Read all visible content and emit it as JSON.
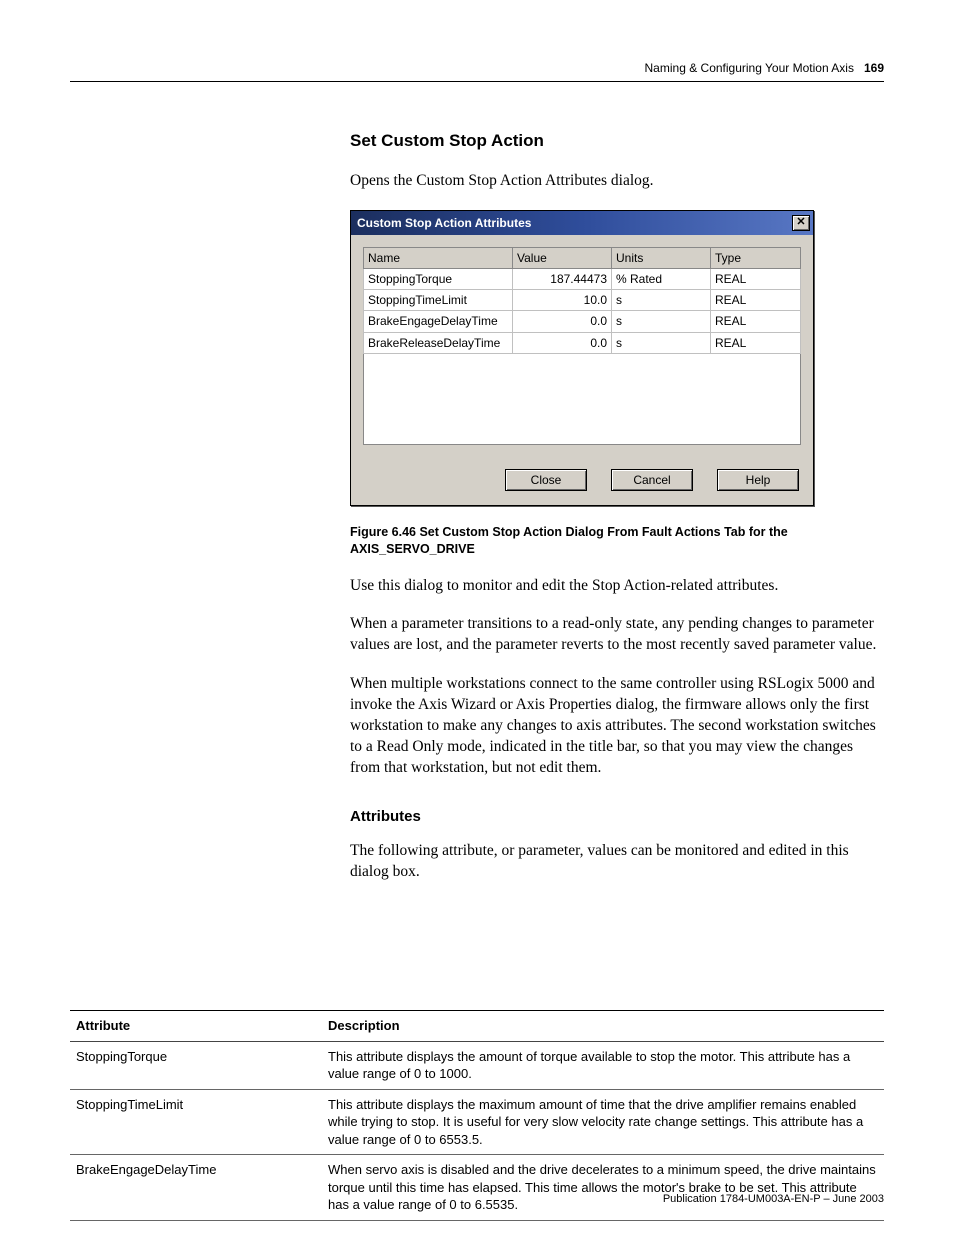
{
  "header": {
    "chapter": "Naming & Configuring Your Motion Axis",
    "page_number": "169"
  },
  "section_title": "Set Custom Stop Action",
  "intro_para": "Opens the Custom Stop Action Attributes dialog.",
  "dialog": {
    "title": "Custom Stop Action Attributes",
    "columns": [
      "Name",
      "Value",
      "Units",
      "Type"
    ],
    "rows": [
      {
        "name": "StoppingTorque",
        "value": "187.44473",
        "units": "% Rated",
        "type": "REAL"
      },
      {
        "name": "StoppingTimeLimit",
        "value": "10.0",
        "units": "s",
        "type": "REAL"
      },
      {
        "name": "BrakeEngageDelayTime",
        "value": "0.0",
        "units": "s",
        "type": "REAL"
      },
      {
        "name": "BrakeReleaseDelayTime",
        "value": "0.0",
        "units": "s",
        "type": "REAL"
      }
    ],
    "buttons": {
      "close": "Close",
      "cancel": "Cancel",
      "help": "Help"
    }
  },
  "figure_caption": "Figure 6.46 Set Custom Stop Action Dialog From Fault Actions Tab for the AXIS_SERVO_DRIVE",
  "para_use": "Use this dialog to monitor and edit the Stop Action-related attributes.",
  "para_readonly": "When a parameter transitions to a read-only state, any pending changes to parameter values are lost, and the parameter reverts to the most recently saved parameter value.",
  "para_multi": "When multiple workstations connect to the same controller using RSLogix 5000 and invoke the Axis Wizard or Axis Properties dialog, the firmware allows only the first workstation to make any changes to axis attributes. The second workstation switches to a Read Only mode, indicated in the title bar, so that you may view the changes from that workstation, but not edit them.",
  "attributes_heading": "Attributes",
  "attributes_intro": "The following attribute, or parameter, values can be monitored and edited in this dialog box.",
  "attr_table": {
    "head": {
      "attribute": "Attribute",
      "description": "Description"
    },
    "rows": [
      {
        "attr": "StoppingTorque",
        "desc": "This attribute displays the amount of torque available to stop the motor. This attribute has a value range of 0 to 1000."
      },
      {
        "attr": "StoppingTimeLimit",
        "desc": "This attribute displays the maximum amount of time that the drive amplifier remains enabled while trying to stop. It is useful for very slow velocity rate change settings. This attribute has a value range of 0 to 6553.5."
      },
      {
        "attr": "BrakeEngageDelayTime",
        "desc": "When servo axis is disabled and the drive decelerates to a minimum speed, the drive maintains torque until this time has elapsed. This time allows the motor's brake to be set. This attribute has a value range of 0 to 6.5535."
      }
    ]
  },
  "footer": "Publication 1784-UM003A-EN-P – June 2003"
}
